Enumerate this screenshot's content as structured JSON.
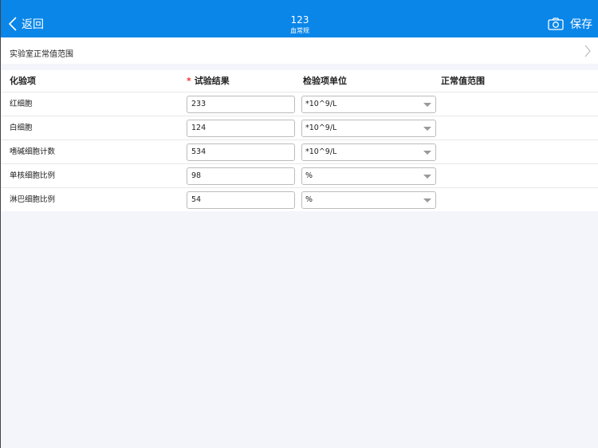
{
  "header": {
    "back_label": "返回",
    "title": "123",
    "subtitle": "血常规",
    "save_label": "保存"
  },
  "lab_range": {
    "label": "实验室正常值范围"
  },
  "table": {
    "headers": {
      "item": "化验项",
      "result_required": "*",
      "result": "试验结果",
      "unit": "检验项单位",
      "range": "正常值范围"
    },
    "rows": [
      {
        "item": "红细胞",
        "result": "233",
        "unit": "*10^9/L",
        "range": ""
      },
      {
        "item": "白细胞",
        "result": "124",
        "unit": "*10^9/L",
        "range": ""
      },
      {
        "item": "嗜碱细胞计数",
        "result": "534",
        "unit": "*10^9/L",
        "range": ""
      },
      {
        "item": "单核细胞比例",
        "result": "98",
        "unit": "%",
        "range": ""
      },
      {
        "item": "淋巴细胞比例",
        "result": "54",
        "unit": "%",
        "range": ""
      }
    ]
  }
}
